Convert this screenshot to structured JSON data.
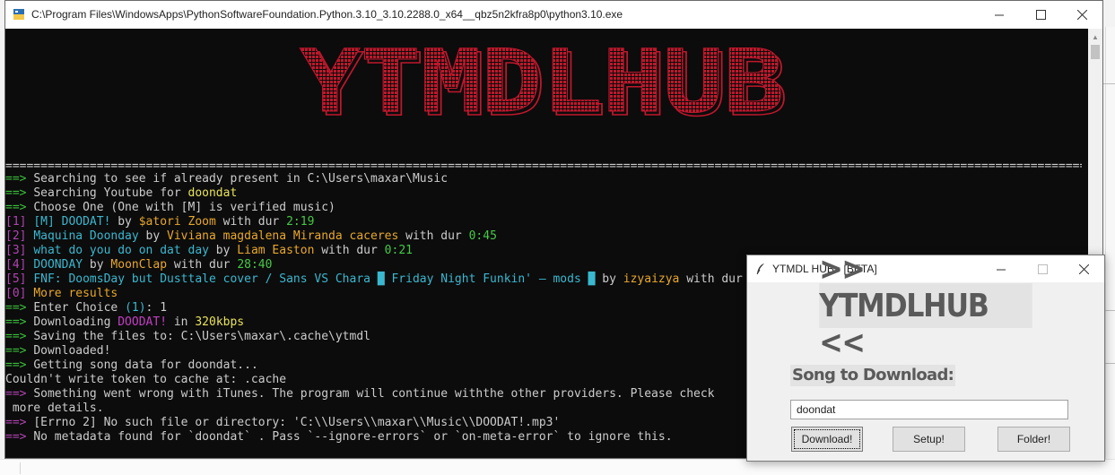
{
  "console": {
    "title": "C:\\Program Files\\WindowsApps\\PythonSoftwareFoundation.Python.3.10_3.10.2288.0_x64__qbz5n2kfra8p0\\python3.10.exe",
    "banner_text": "YTMDLHUB",
    "rule": "=================================================================================================================================================================================================================",
    "lines": [
      [
        {
          "t": "==> ",
          "c": "g"
        },
        {
          "t": "Searching to see if already present in C:\\Users\\maxar\\Music",
          "c": "w"
        }
      ],
      [
        {
          "t": "==> ",
          "c": "g"
        },
        {
          "t": "Searching Youtube for ",
          "c": "w"
        },
        {
          "t": "doondat",
          "c": "y"
        }
      ],
      [
        {
          "t": "==> ",
          "c": "g"
        },
        {
          "t": "Choose One (One with [M] is verified music)",
          "c": "w"
        }
      ],
      [
        {
          "t": "[1] ",
          "c": "m"
        },
        {
          "t": "[M] DOODAT!",
          "c": "c"
        },
        {
          "t": " by ",
          "c": "w"
        },
        {
          "t": "$atori Zoom",
          "c": "o"
        },
        {
          "t": " with dur ",
          "c": "w"
        },
        {
          "t": "2:19",
          "c": "gr"
        }
      ],
      [
        {
          "t": "[2] ",
          "c": "m"
        },
        {
          "t": "Maquina Doonday",
          "c": "c"
        },
        {
          "t": " by ",
          "c": "w"
        },
        {
          "t": "Viviana magdalena Miranda caceres",
          "c": "o"
        },
        {
          "t": " with dur ",
          "c": "w"
        },
        {
          "t": "0:45",
          "c": "gr"
        }
      ],
      [
        {
          "t": "[3] ",
          "c": "m"
        },
        {
          "t": "what do you do on dat day",
          "c": "c"
        },
        {
          "t": " by ",
          "c": "w"
        },
        {
          "t": "Liam Easton",
          "c": "o"
        },
        {
          "t": " with dur ",
          "c": "w"
        },
        {
          "t": "0:21",
          "c": "gr"
        }
      ],
      [
        {
          "t": "[4] ",
          "c": "m"
        },
        {
          "t": "DOONDAY",
          "c": "c"
        },
        {
          "t": " by ",
          "c": "w"
        },
        {
          "t": "MoonClap",
          "c": "o"
        },
        {
          "t": " with dur ",
          "c": "w"
        },
        {
          "t": "28:40",
          "c": "gr"
        }
      ],
      [
        {
          "t": "[5] ",
          "c": "m"
        },
        {
          "t": "FNF: DoomsDay but Dusttale cover / Sans VS Chara █ Friday Night Funkin' – mods █",
          "c": "c"
        },
        {
          "t": " by ",
          "c": "w"
        },
        {
          "t": "izyaizya",
          "c": "o"
        },
        {
          "t": " with dur ",
          "c": "w"
        }
      ],
      [
        {
          "t": "[0] ",
          "c": "m"
        },
        {
          "t": "More results",
          "c": "o"
        }
      ],
      [
        {
          "t": "==> ",
          "c": "g"
        },
        {
          "t": "Enter Choice ",
          "c": "w"
        },
        {
          "t": "(1)",
          "c": "c"
        },
        {
          "t": ": 1",
          "c": "w"
        }
      ],
      [
        {
          "t": "==> ",
          "c": "g"
        },
        {
          "t": "Downloading ",
          "c": "w"
        },
        {
          "t": "DOODAT!",
          "c": "mp"
        },
        {
          "t": " in ",
          "c": "w"
        },
        {
          "t": "320kbps",
          "c": "y"
        }
      ],
      [
        {
          "t": "==> ",
          "c": "g"
        },
        {
          "t": "Saving the files to: C:\\Users\\maxar\\.cache\\ytmdl",
          "c": "w"
        }
      ],
      [
        {
          "t": "==> ",
          "c": "g"
        },
        {
          "t": "Downloaded!",
          "c": "w"
        }
      ],
      [
        {
          "t": "==> ",
          "c": "g"
        },
        {
          "t": "Getting song data for doondat...",
          "c": "w"
        }
      ],
      [
        {
          "t": "Couldn't write token to cache at: .cache",
          "c": "w"
        }
      ],
      [
        {
          "t": "==> ",
          "c": "m"
        },
        {
          "t": "Something went wrong with iTunes. The program will continue withthe other providers. Please check",
          "c": "w"
        }
      ],
      [
        {
          "t": " more details.",
          "c": "w"
        }
      ],
      [
        {
          "t": "==> ",
          "c": "m"
        },
        {
          "t": "[Errno 2] No such file or directory: 'C:\\\\Users\\\\maxar\\\\Music\\\\DOODAT!.mp3'",
          "c": "w"
        }
      ],
      [
        {
          "t": "==> ",
          "c": "m"
        },
        {
          "t": "No metadata found for `doondat` . Pass `--ignore-errors` or `on-meta-error` to ignore this.",
          "c": "w"
        }
      ]
    ]
  },
  "dialog": {
    "title": "YTMDL HUB - [BETA]",
    "heading": ">> YTMDLHUB <<",
    "song_label": "Song to Download:",
    "song_value": "doondat",
    "download_label": "Download!",
    "setup_label": "Setup!",
    "folder_label": "Folder!"
  },
  "colors": {
    "banner": "#c0172c",
    "terminal_bg": "#0c0c0c",
    "prompt_green": "#3bbf3b",
    "index_magenta": "#b044b0"
  },
  "icons": {
    "console_app": "python-icon",
    "dialog_app": "feather-icon"
  }
}
